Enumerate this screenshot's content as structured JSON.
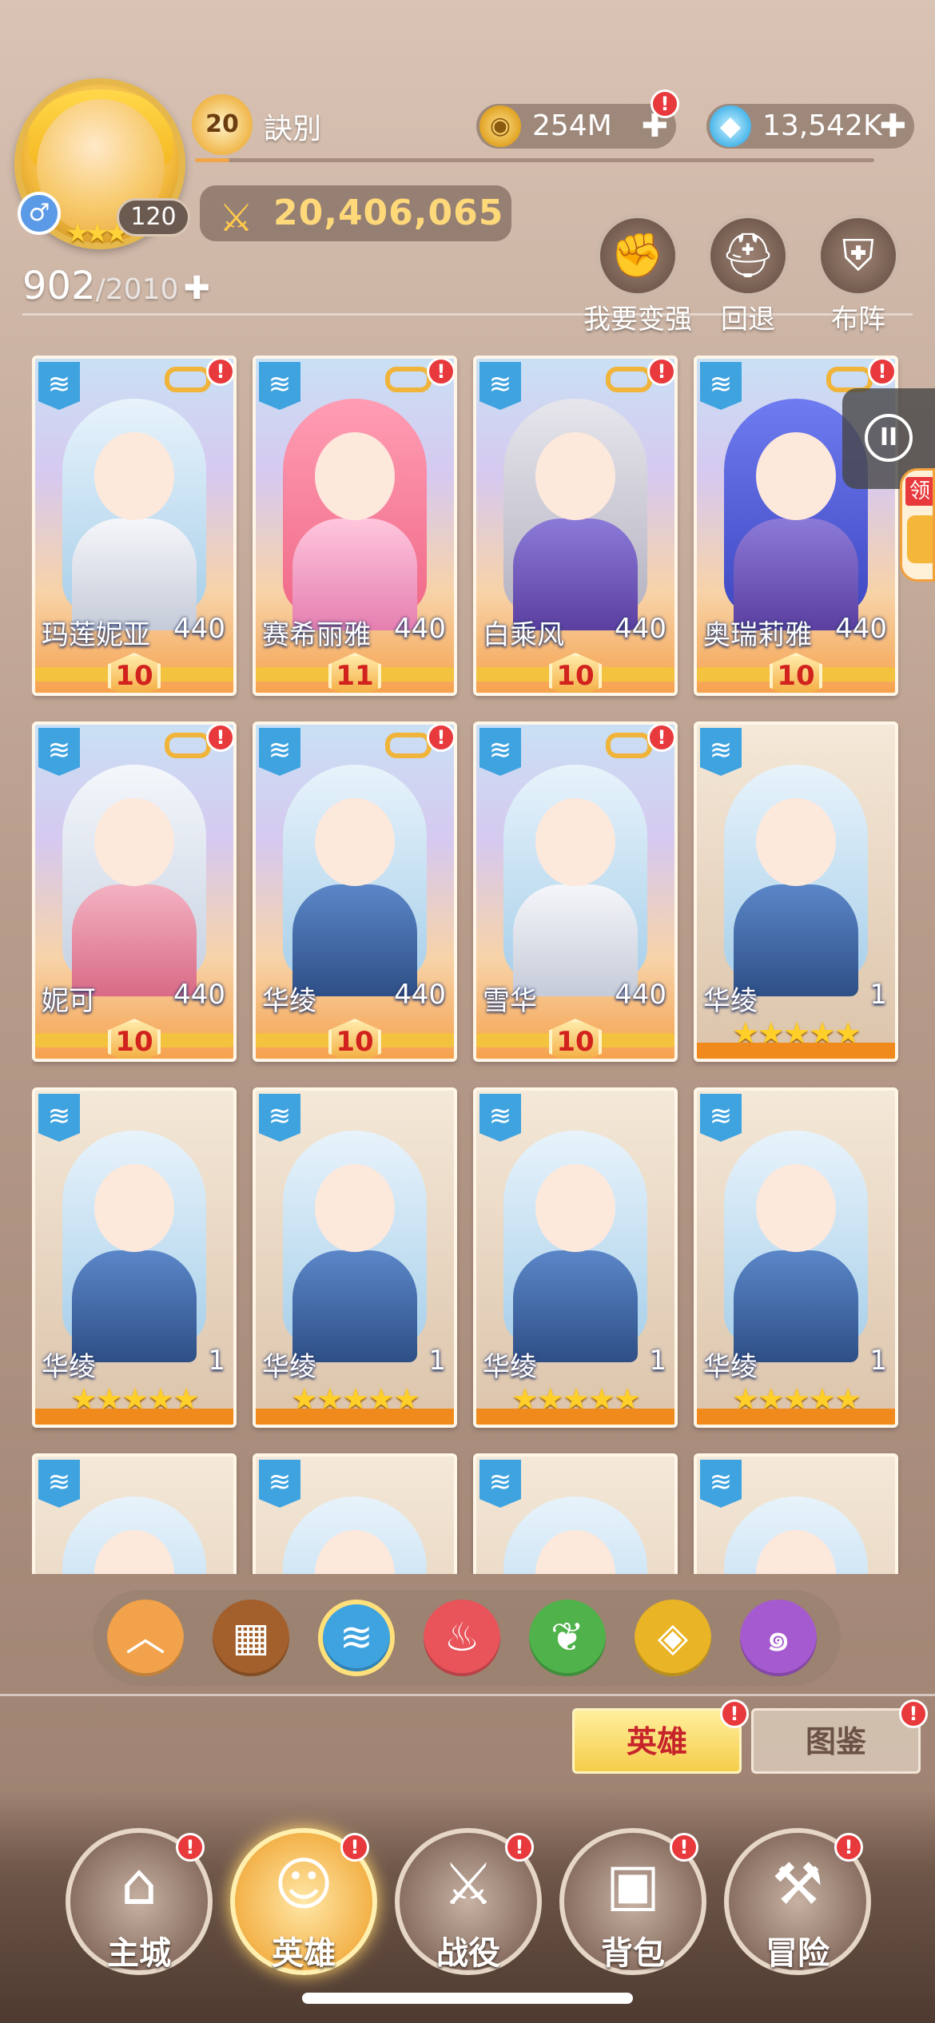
{
  "player": {
    "level": "20",
    "name": "訣別",
    "avatar_level": "120",
    "power": "20,406,065",
    "stamina_current": "902",
    "stamina_max": "/2010"
  },
  "currency": {
    "gold": "254M",
    "gems": "13,542K"
  },
  "quick_actions": [
    {
      "label": "我要变强",
      "icon": "fist-icon"
    },
    {
      "label": "回退",
      "icon": "helmet-icon"
    },
    {
      "label": "布阵",
      "icon": "shield-icon"
    }
  ],
  "side": {
    "reward_tag": "领"
  },
  "heroes": [
    {
      "name": "玛莲妮亚",
      "level": "440",
      "rank": "10",
      "hair": "ice",
      "body": "white",
      "rainbow": true,
      "linked": true,
      "alert": true
    },
    {
      "name": "赛希丽雅",
      "level": "440",
      "rank": "11",
      "hair": "pink",
      "body": "pink",
      "rainbow": true,
      "linked": true,
      "alert": true
    },
    {
      "name": "白乘风",
      "level": "440",
      "rank": "10",
      "hair": "silver",
      "body": "purple",
      "rainbow": true,
      "linked": true,
      "alert": true
    },
    {
      "name": "奥瑞莉雅",
      "level": "440",
      "rank": "10",
      "hair": "blue",
      "body": "purple",
      "rainbow": true,
      "linked": true,
      "alert": true
    },
    {
      "name": "妮可",
      "level": "440",
      "rank": "10",
      "hair": "white",
      "body": "red",
      "rainbow": true,
      "linked": true,
      "alert": true
    },
    {
      "name": "华绫",
      "level": "440",
      "rank": "10",
      "hair": "ice",
      "body": "blue",
      "rainbow": true,
      "linked": true,
      "alert": true
    },
    {
      "name": "雪华",
      "level": "440",
      "rank": "10",
      "hair": "ice",
      "body": "white",
      "rainbow": true,
      "linked": true,
      "alert": true
    },
    {
      "name": "华绫",
      "level": "1",
      "stars": "★★★★★",
      "hair": "ice",
      "body": "blue",
      "rainbow": false
    },
    {
      "name": "华绫",
      "level": "1",
      "stars": "★★★★★",
      "hair": "ice",
      "body": "blue",
      "rainbow": false
    },
    {
      "name": "华绫",
      "level": "1",
      "stars": "★★★★★",
      "hair": "ice",
      "body": "blue",
      "rainbow": false
    },
    {
      "name": "华绫",
      "level": "1",
      "stars": "★★★★★",
      "hair": "ice",
      "body": "blue",
      "rainbow": false
    },
    {
      "name": "华绫",
      "level": "1",
      "stars": "★★★★★",
      "hair": "ice",
      "body": "blue",
      "rainbow": false
    },
    {
      "name": "",
      "level": "",
      "hair": "ice",
      "body": "blue",
      "rainbow": false
    },
    {
      "name": "",
      "level": "",
      "hair": "ice",
      "body": "blue",
      "rainbow": false
    },
    {
      "name": "",
      "level": "",
      "hair": "ice",
      "body": "blue",
      "rainbow": false
    },
    {
      "name": "",
      "level": "",
      "hair": "ice",
      "body": "blue",
      "rainbow": false
    }
  ],
  "filters": [
    {
      "name": "collapse",
      "icon": "chevron-up-icon",
      "glyph": "︿",
      "color": "#f2a24a"
    },
    {
      "name": "all",
      "icon": "grid-icon",
      "glyph": "▦",
      "color": "#a35f2c"
    },
    {
      "name": "water",
      "icon": "water-icon",
      "glyph": "≋",
      "color": "#3fa3e0",
      "active": true
    },
    {
      "name": "fire",
      "icon": "fire-icon",
      "glyph": "♨",
      "color": "#e8545a"
    },
    {
      "name": "wood",
      "icon": "leaf-icon",
      "glyph": "❦",
      "color": "#4fb24a"
    },
    {
      "name": "light",
      "icon": "eye-icon",
      "glyph": "◈",
      "color": "#e9b425"
    },
    {
      "name": "dark",
      "icon": "swirl-icon",
      "glyph": "๑",
      "color": "#a65ad0"
    }
  ],
  "tabs": {
    "heroes": "英雄",
    "codex": "图鉴"
  },
  "nav": [
    {
      "label": "主城",
      "icon": "castle-icon",
      "glyph": "⌂"
    },
    {
      "label": "英雄",
      "icon": "hero-icon",
      "glyph": "☺",
      "active": true
    },
    {
      "label": "战役",
      "icon": "swords-icon",
      "glyph": "⚔"
    },
    {
      "label": "背包",
      "icon": "backpack-icon",
      "glyph": "▣"
    },
    {
      "label": "冒险",
      "icon": "adventure-icon",
      "glyph": "⚒"
    }
  ],
  "alert_glyph": "!",
  "plus_glyph": "✚",
  "pause_glyph": "II"
}
